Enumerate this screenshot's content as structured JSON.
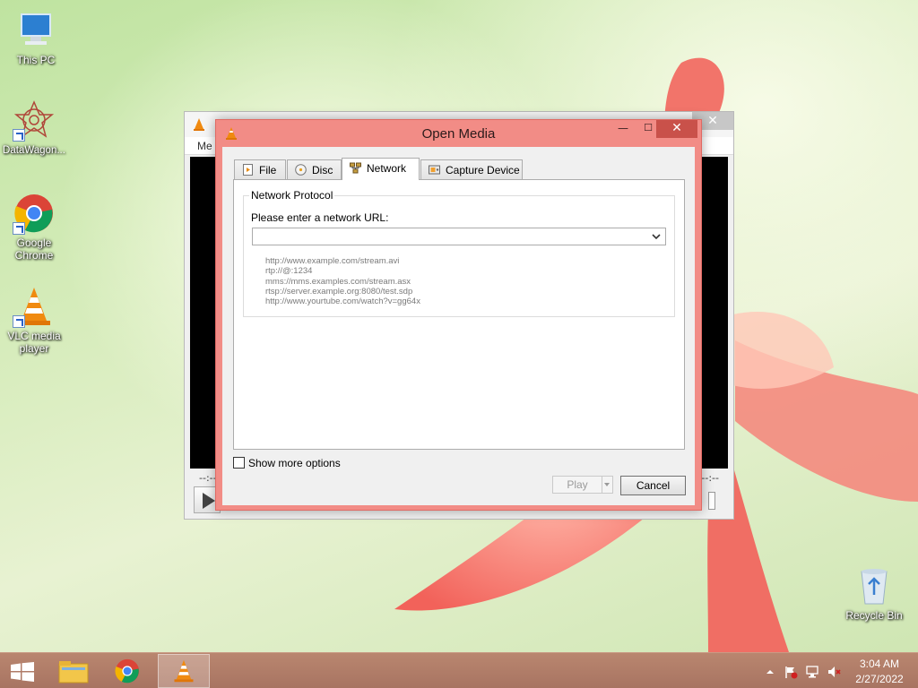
{
  "desktop": {
    "icons": [
      {
        "label": "This PC"
      },
      {
        "label": "DataWagon..."
      },
      {
        "label": "Google\nChrome"
      },
      {
        "label": "VLC media\nplayer"
      },
      {
        "label": "Recycle Bin"
      }
    ]
  },
  "vlc_main": {
    "menu_partial": "Me",
    "time_left": "--:--",
    "time_right": "--:--"
  },
  "dialog": {
    "title": "Open Media",
    "tabs": [
      {
        "label": "File",
        "icon": "file-icon"
      },
      {
        "label": "Disc",
        "icon": "disc-icon"
      },
      {
        "label": "Network",
        "icon": "network-icon",
        "active": true
      },
      {
        "label": "Capture Device",
        "icon": "capture-device-icon"
      }
    ],
    "group_title": "Network Protocol",
    "url_label": "Please enter a network URL:",
    "url_value": "",
    "examples": [
      "http://www.example.com/stream.avi",
      "rtp://@:1234",
      "mms://mms.examples.com/stream.asx",
      "rtsp://server.example.org:8080/test.sdp",
      "http://www.yourtube.com/watch?v=gg64x"
    ],
    "show_more_options": "Show more options",
    "play_label": "Play",
    "cancel_label": "Cancel"
  },
  "taskbar": {
    "time": "3:04 AM",
    "date": "2/27/2022"
  },
  "colors": {
    "dialog_frame": "#f28c86",
    "close_button": "#c9514a",
    "taskbar": "#a87462"
  }
}
